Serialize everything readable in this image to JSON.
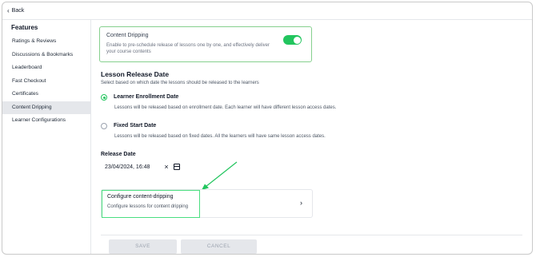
{
  "topbar": {
    "back_label": "Back"
  },
  "sidebar": {
    "title": "Features",
    "items": [
      {
        "label": "Ratings & Reviews"
      },
      {
        "label": "Discussions & Bookmarks"
      },
      {
        "label": "Leaderboard"
      },
      {
        "label": "Fast Checkout"
      },
      {
        "label": "Certificates"
      },
      {
        "label": "Content Dripping",
        "active": true
      },
      {
        "label": "Learner Configurations"
      }
    ]
  },
  "dripping": {
    "title": "Content Dripping",
    "description": "Enable to pre-schedule release of lessons one by one, and effectively deliver your course contents",
    "enabled": true
  },
  "release": {
    "section_title": "Lesson Release Date",
    "section_subtitle": "Select based on which date the lessons should be released to the learners",
    "options": [
      {
        "label": "Learner Enrollment Date",
        "description": "Lessons will be released based on enrollment date. Each learner will have different lesson access dates.",
        "selected": true
      },
      {
        "label": "Fixed Start Date",
        "description": "Lessons will be released based on fixed dates. All the learners will have same lesson access dates.",
        "selected": false
      }
    ],
    "date_label": "Release Date",
    "date_value": "23/04/2024, 16:48"
  },
  "config": {
    "title": "Configure content-dripping",
    "description": "Configure lessons for content dripping"
  },
  "actions": {
    "save_label": "SAVE",
    "cancel_label": "CANCEL"
  },
  "colors": {
    "accent": "#22c55e",
    "highlight_border": "#4ade80",
    "arrow": "#22c55e"
  }
}
